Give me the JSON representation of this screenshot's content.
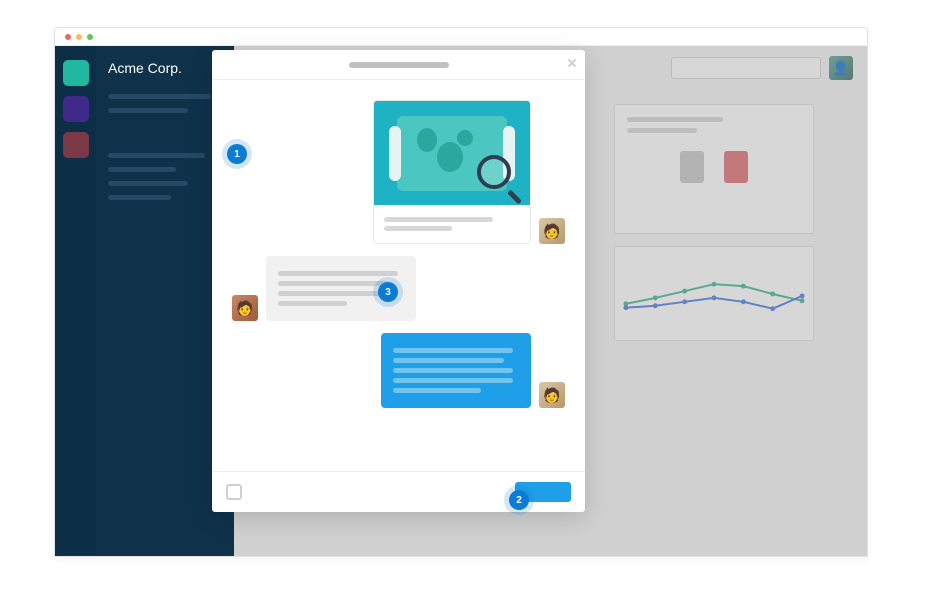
{
  "org": {
    "name": "Acme Corp."
  },
  "steps": {
    "one": "1",
    "two": "2",
    "three": "3"
  },
  "workspace_colors": {
    "green": "#20b89e",
    "purple": "#3f2a8c",
    "maroon": "#7a3944"
  },
  "theme": {
    "accent": "#1e9fe8",
    "sidebar_bg": "#0f324b"
  }
}
